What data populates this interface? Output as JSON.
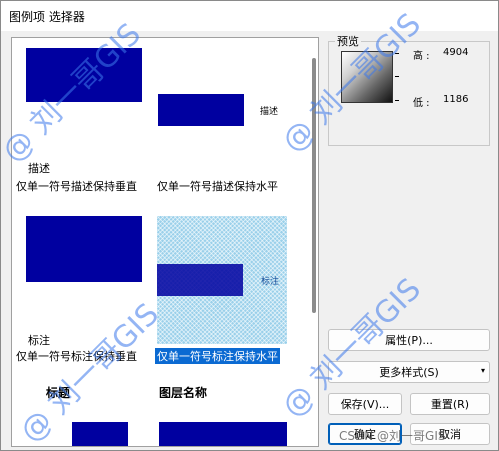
{
  "window": {
    "title": "图例项 选择器"
  },
  "gallery": {
    "items": [
      {
        "cell_text": "",
        "caption_top": "描述",
        "caption": "仅单一符号描述保持垂直"
      },
      {
        "cell_text": "描述",
        "caption_top": "",
        "caption": "仅单一符号描述保持水平"
      },
      {
        "cell_text": "",
        "caption_top": "标注",
        "caption": "仅单一符号标注保持垂直"
      },
      {
        "cell_text": "标注",
        "caption_top": "",
        "caption": "仅单一符号标注保持水平",
        "selected": true
      },
      {
        "cell_text": "标题",
        "caption_top": "",
        "caption": ""
      },
      {
        "cell_text": "图层名称",
        "caption_top": "",
        "caption": ""
      }
    ]
  },
  "preview": {
    "label": "预览",
    "high_label": "高 :",
    "high_value": "4904",
    "low_label": "低 :",
    "low_value": "1186"
  },
  "buttons": {
    "properties": "属性(P)...",
    "more_styles": "更多样式(S)",
    "save": "保存(V)...",
    "reset": "重置(R)",
    "ok": "确定",
    "cancel": "取消"
  },
  "watermark": {
    "text": "@ 刘一哥GIS",
    "footer": "CSDN @刘一哥GIS"
  },
  "colors": {
    "symbol_fill": "#0000a0",
    "selection": "#0b6ad2",
    "watermark": "#3c78eb"
  }
}
